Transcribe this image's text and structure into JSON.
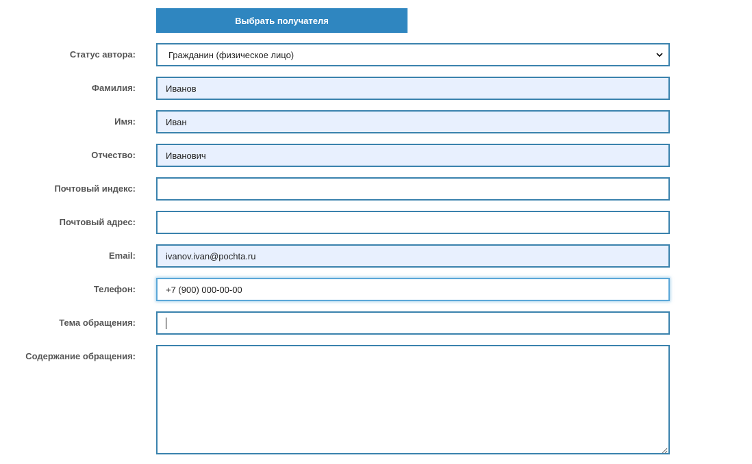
{
  "buttons": {
    "choose_recipient": "Выбрать получателя"
  },
  "form": {
    "author_status": {
      "label": "Статус автора:",
      "value": "Гражданин (физическое лицо)"
    },
    "last_name": {
      "label": "Фамилия:",
      "value": "Иванов"
    },
    "first_name": {
      "label": "Имя:",
      "value": "Иван"
    },
    "patronymic": {
      "label": "Отчество:",
      "value": "Иванович"
    },
    "postal_code": {
      "label": "Почтовый индекс:",
      "value": ""
    },
    "postal_address": {
      "label": "Почтовый адрес:",
      "value": ""
    },
    "email": {
      "label": "Email:",
      "value": "ivanov.ivan@pochta.ru"
    },
    "phone": {
      "label": "Телефон:",
      "value": "+7 (900) 000-00-00"
    },
    "subject": {
      "label": "Тема обращения:",
      "value": ""
    },
    "content": {
      "label": "Содержание обращения:",
      "value": ""
    }
  },
  "icons": {
    "select_chevron": "chevron-down-icon",
    "resize": "resize-grip-icon"
  },
  "colors": {
    "button_bg": "#2f86c0",
    "field_border": "#3a82ad",
    "autofill_bg": "#e8f0fe",
    "label_text": "#555555"
  }
}
